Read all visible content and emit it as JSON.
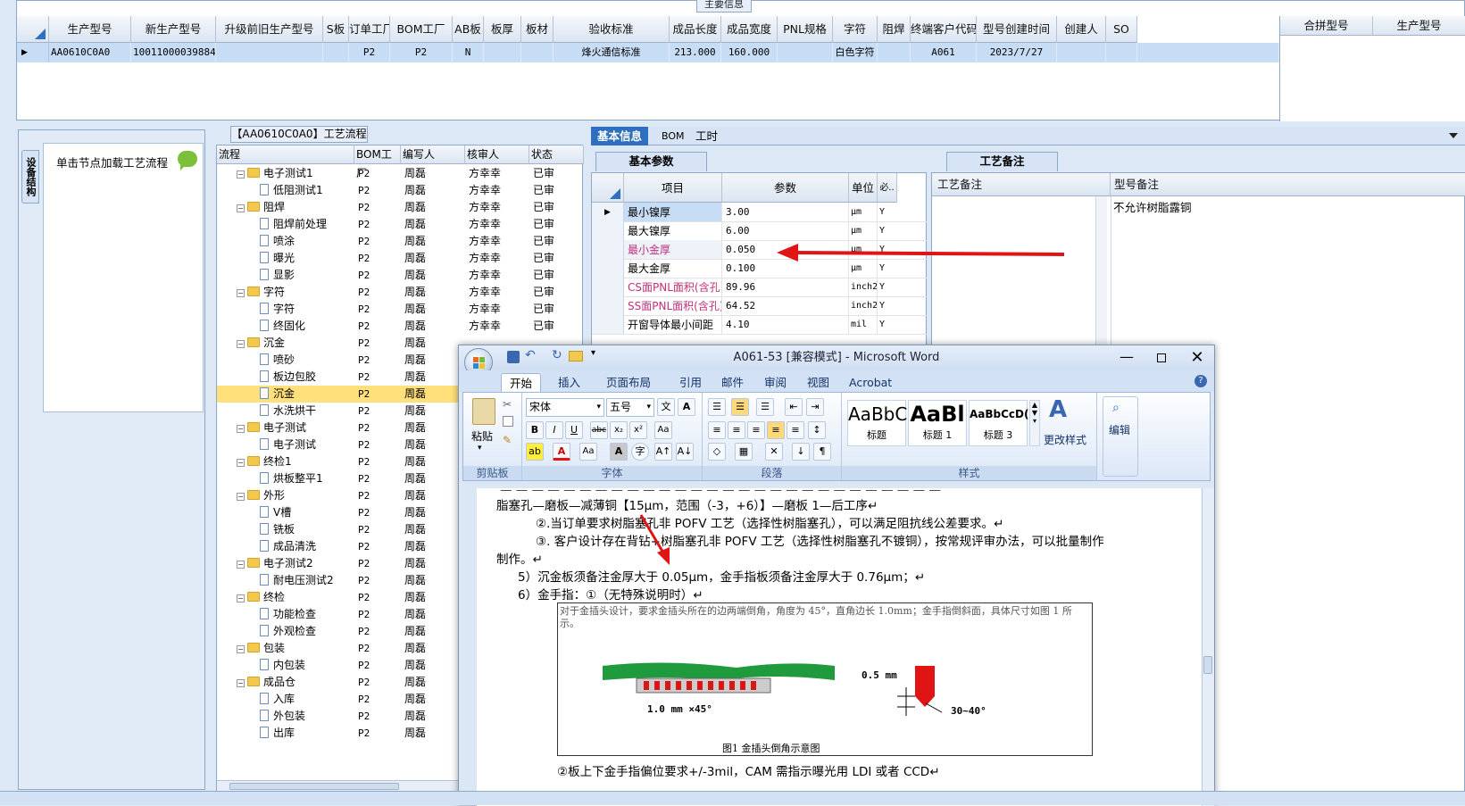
{
  "main_info": {
    "title": "主要信息",
    "columns": [
      "生产型号",
      "新生产型号",
      "升级前旧生产型号",
      "S板",
      "订单工厂",
      "BOM工厂",
      "AB板",
      "板厚",
      "板材",
      "验收标准",
      "成品长度",
      "成品宽度",
      "PNL规格",
      "字符",
      "阻焊",
      "终端客户代码",
      "型号创建时间",
      "创建人",
      "SO"
    ],
    "row": [
      "AA0610C0A0",
      "10011000039884",
      "",
      "",
      "P2",
      "P2",
      "N",
      "",
      "",
      "烽火通信标准",
      "213.000",
      "160.000",
      "",
      "白色字符",
      "",
      "A061",
      "2023/7/27",
      "",
      ""
    ],
    "right_columns": [
      "合拼型号",
      "生产型号"
    ]
  },
  "left_panel": {
    "vertical_tab": "设备结构",
    "load_label": "单击节点加载工艺流程"
  },
  "process": {
    "title": "【AA0610C0A0】工艺流程",
    "columns": [
      "流程",
      "BOM工厂",
      "编写人",
      "核审人",
      "状态"
    ],
    "rows": [
      {
        "name": "电子测试1",
        "level": 0,
        "factory": "P2",
        "author": "周磊",
        "reviewer": "方幸幸",
        "status": "已审"
      },
      {
        "name": "低阻测试1",
        "level": 1,
        "factory": "P2",
        "author": "周磊",
        "reviewer": "方幸幸",
        "status": "已审"
      },
      {
        "name": "阻焊",
        "level": 0,
        "factory": "P2",
        "author": "周磊",
        "reviewer": "方幸幸",
        "status": "已审"
      },
      {
        "name": "阻焊前处理",
        "level": 1,
        "factory": "P2",
        "author": "周磊",
        "reviewer": "方幸幸",
        "status": "已审"
      },
      {
        "name": "喷涂",
        "level": 1,
        "factory": "P2",
        "author": "周磊",
        "reviewer": "方幸幸",
        "status": "已审"
      },
      {
        "name": "曝光",
        "level": 1,
        "factory": "P2",
        "author": "周磊",
        "reviewer": "方幸幸",
        "status": "已审"
      },
      {
        "name": "显影",
        "level": 1,
        "factory": "P2",
        "author": "周磊",
        "reviewer": "方幸幸",
        "status": "已审"
      },
      {
        "name": "字符",
        "level": 0,
        "factory": "P2",
        "author": "周磊",
        "reviewer": "方幸幸",
        "status": "已审"
      },
      {
        "name": "字符",
        "level": 1,
        "factory": "P2",
        "author": "周磊",
        "reviewer": "方幸幸",
        "status": "已审"
      },
      {
        "name": "终固化",
        "level": 1,
        "factory": "P2",
        "author": "周磊",
        "reviewer": "方幸幸",
        "status": "已审"
      },
      {
        "name": "沉金",
        "level": 0,
        "factory": "P2",
        "author": "周磊",
        "reviewer": "",
        "status": ""
      },
      {
        "name": "喷砂",
        "level": 1,
        "factory": "P2",
        "author": "周磊",
        "reviewer": "",
        "status": ""
      },
      {
        "name": "板边包胶",
        "level": 1,
        "factory": "P2",
        "author": "周磊",
        "reviewer": "",
        "status": ""
      },
      {
        "name": "沉金",
        "level": 1,
        "factory": "P2",
        "author": "周磊",
        "reviewer": "",
        "status": "",
        "selected": true
      },
      {
        "name": "水洗烘干",
        "level": 1,
        "factory": "P2",
        "author": "周磊",
        "reviewer": "",
        "status": ""
      },
      {
        "name": "电子测试",
        "level": 0,
        "factory": "P2",
        "author": "周磊",
        "reviewer": "",
        "status": ""
      },
      {
        "name": "电子测试",
        "level": 1,
        "factory": "P2",
        "author": "周磊",
        "reviewer": "",
        "status": ""
      },
      {
        "name": "终检1",
        "level": 0,
        "factory": "P2",
        "author": "周磊",
        "reviewer": "",
        "status": ""
      },
      {
        "name": "烘板整平1",
        "level": 1,
        "factory": "P2",
        "author": "周磊",
        "reviewer": "",
        "status": ""
      },
      {
        "name": "外形",
        "level": 0,
        "factory": "P2",
        "author": "周磊",
        "reviewer": "",
        "status": ""
      },
      {
        "name": "V槽",
        "level": 1,
        "factory": "P2",
        "author": "周磊",
        "reviewer": "",
        "status": ""
      },
      {
        "name": "铣板",
        "level": 1,
        "factory": "P2",
        "author": "周磊",
        "reviewer": "",
        "status": ""
      },
      {
        "name": "成品清洗",
        "level": 1,
        "factory": "P2",
        "author": "周磊",
        "reviewer": "",
        "status": ""
      },
      {
        "name": "电子测试2",
        "level": 0,
        "factory": "P2",
        "author": "周磊",
        "reviewer": "",
        "status": ""
      },
      {
        "name": "耐电压测试2",
        "level": 1,
        "factory": "P2",
        "author": "周磊",
        "reviewer": "",
        "status": ""
      },
      {
        "name": "终检",
        "level": 0,
        "factory": "P2",
        "author": "周磊",
        "reviewer": "",
        "status": ""
      },
      {
        "name": "功能检查",
        "level": 1,
        "factory": "P2",
        "author": "周磊",
        "reviewer": "",
        "status": ""
      },
      {
        "name": "外观检查",
        "level": 1,
        "factory": "P2",
        "author": "周磊",
        "reviewer": "",
        "status": ""
      },
      {
        "name": "包装",
        "level": 0,
        "factory": "P2",
        "author": "周磊",
        "reviewer": "",
        "status": ""
      },
      {
        "name": "内包装",
        "level": 1,
        "factory": "P2",
        "author": "周磊",
        "reviewer": "",
        "status": ""
      },
      {
        "name": "成品仓",
        "level": 0,
        "factory": "P2",
        "author": "周磊",
        "reviewer": "",
        "status": ""
      },
      {
        "name": "入库",
        "level": 1,
        "factory": "P2",
        "author": "周磊",
        "reviewer": "",
        "status": ""
      },
      {
        "name": "外包装",
        "level": 1,
        "factory": "P2",
        "author": "周磊",
        "reviewer": "",
        "status": ""
      },
      {
        "name": "出库",
        "level": 1,
        "factory": "P2",
        "author": "周磊",
        "reviewer": "",
        "status": ""
      }
    ]
  },
  "right_tabs": [
    "基本信息",
    "BOM",
    "工时"
  ],
  "basic_params": {
    "title": "基本参数",
    "columns": [
      "项目",
      "参数",
      "单位",
      "必.."
    ],
    "rows": [
      {
        "item": "最小镍厚",
        "value": "3.00",
        "unit": "μm",
        "req": "Y",
        "pink": false
      },
      {
        "item": "最大镍厚",
        "value": "6.00",
        "unit": "μm",
        "req": "Y",
        "pink": false
      },
      {
        "item": "最小金厚",
        "value": "0.050",
        "unit": "μm",
        "req": "Y",
        "pink": true
      },
      {
        "item": "最大金厚",
        "value": "0.100",
        "unit": "μm",
        "req": "Y",
        "pink": false
      },
      {
        "item": "CS面PNL面积(含孔)",
        "value": "89.96",
        "unit": "inch2",
        "req": "Y",
        "pink": true
      },
      {
        "item": "SS面PNL面积(含孔)",
        "value": "64.52",
        "unit": "inch2",
        "req": "Y",
        "pink": true
      },
      {
        "item": "开窗导体最小间距",
        "value": "4.10",
        "unit": "mil",
        "req": "Y",
        "pink": false
      }
    ]
  },
  "remarks": {
    "title": "工艺备注",
    "col1": "工艺备注",
    "col2": "型号备注",
    "model_remark": "不允许树脂露铜"
  },
  "word": {
    "title": "A061-53 [兼容模式] - Microsoft Word",
    "tabs": [
      "开始",
      "插入",
      "页面布局",
      "引用",
      "邮件",
      "审阅",
      "视图",
      "Acrobat"
    ],
    "font_name": "宋体",
    "font_size": "五号",
    "groups": [
      "剪贴板",
      "字体",
      "段落",
      "样式"
    ],
    "paste_label": "粘贴",
    "styles": [
      {
        "preview": "AaBbC(",
        "label": "标题"
      },
      {
        "preview": "AaBl",
        "label": "标题 1"
      },
      {
        "preview": "AaBbCcD(",
        "label": "标题 3"
      }
    ],
    "change_style": "更改样式",
    "edit": "编辑",
    "doc_lines": [
      "脂塞孔—磨板—减薄铜【15μm，范围（-3，+6）】—磨板 1—后工序↵",
      "②.当订单要求树脂塞孔非 POFV 工艺（选择性树脂塞孔），可以满足阻抗线公差要求。↵",
      "③. 客户设计存在背钻+树脂塞孔非 POFV 工艺（选择性树脂塞孔不镀铜），按常规评审办法，可以批量制作",
      "制作。↵",
      "5）沉金板须备注金厚大于 0.05μm，金手指板须备注金厚大于 0.76μm；↵",
      "6）金手指：①（无特殊说明时）↵",
      "②板上下金手指偏位要求+/-3mil，CAM 需指示曝光用 LDI 或者 CCD↵"
    ],
    "figure_caption": "图1    金插头倒角示意图",
    "figure_labels": {
      "a": "1.0 mm ×45°",
      "b": "0.5 mm",
      "c": "30~40°"
    },
    "figure_note": "对于金插头设计，要求金插头所在的边两端倒角，角度为 45°，直角边长 1.0mm；金手指倒斜面，具体尺寸如图 1 所示。"
  }
}
